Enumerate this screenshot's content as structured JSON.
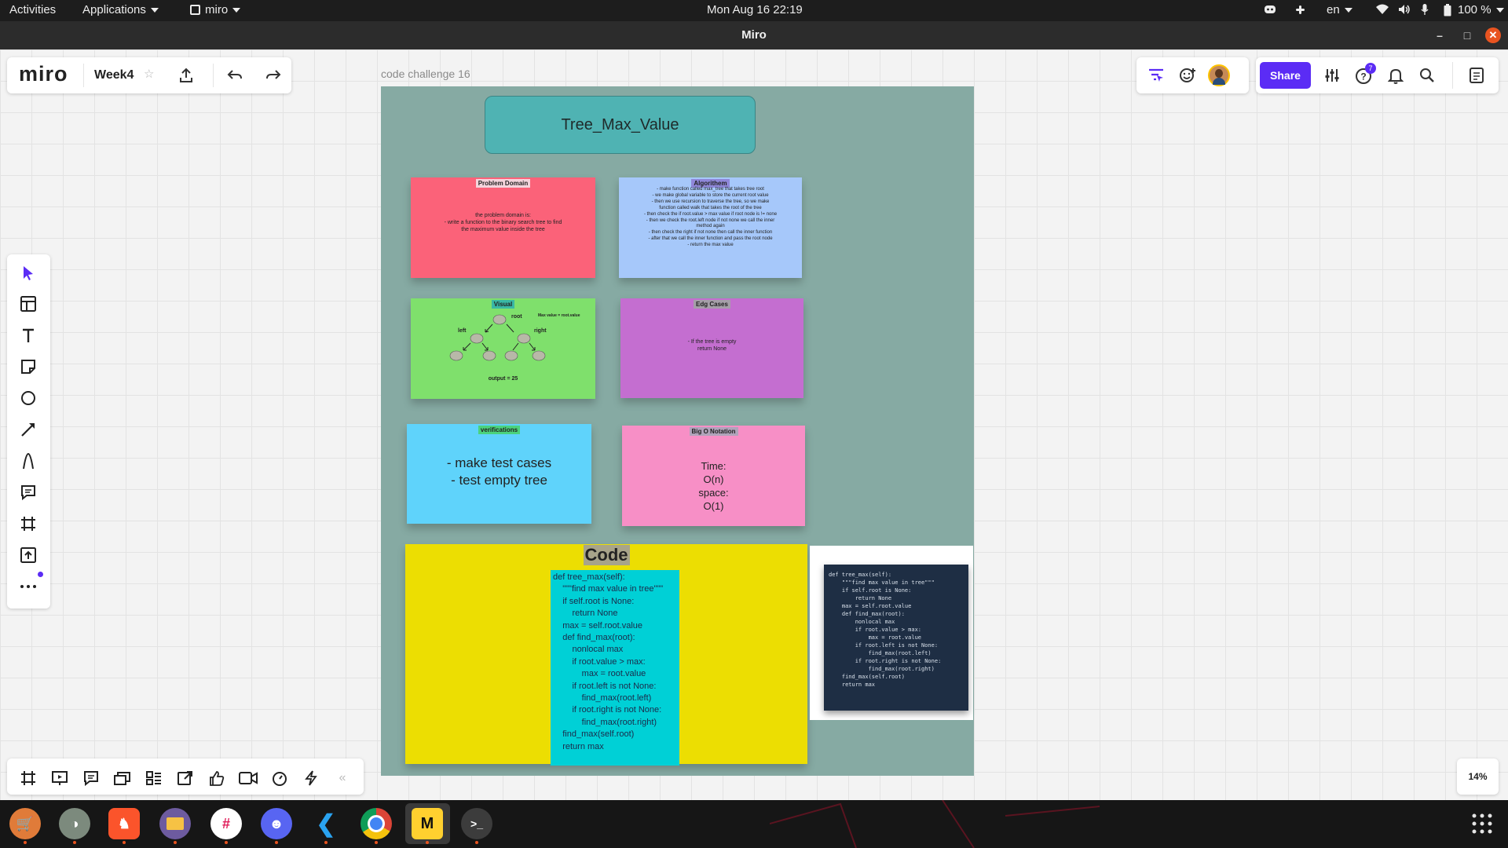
{
  "topbar": {
    "activities": "Activities",
    "applications": "Applications",
    "app": "miro",
    "clock": "Mon Aug 16  22:19",
    "language": "en",
    "battery": "100 %"
  },
  "window": {
    "title": "Miro"
  },
  "miro": {
    "logo": "miro",
    "board_name": "Week4",
    "share_label": "Share",
    "help_badge": "7",
    "zoom": "14%",
    "accent_color": "#5b2cf5"
  },
  "board": {
    "frame_label": "code challenge 16",
    "title_card": "Tree_Max_Value",
    "problem_domain": {
      "header": "Problem Domain",
      "body": "the problem domain is:\n- write a function to the binary search tree to find\nthe maximum value inside the tree"
    },
    "algorithm": {
      "header": "Algorithem",
      "body": "- make function called max_tree that takes tree root\n- we make global variable to store the current root value\n- then we use recursion to traverse the tree, so we make\nfunction called walk that takes the root of the tree\n- then check the if root.value > max value if root node is != none\n- then we check the root.left node if not none we call the inner\nmethod again\n- then check the right if not none then call the inner function\n- after that we call the inner function and pass the root node\n- return the max value"
    },
    "visual": {
      "header": "Visual",
      "root_label": "root",
      "left_label": "left",
      "right_label": "right",
      "max_note": "Max value = root.value",
      "output": "output = 25"
    },
    "edge_cases": {
      "header": "Edg Cases",
      "body": "- If the tree is empty\nreturn None"
    },
    "verifications": {
      "header": "verifications",
      "body": "- make test cases\n- test empty tree"
    },
    "big_o": {
      "header": "Big O Notation",
      "line1": "Time:",
      "line2": "O(n)",
      "line3": "space:",
      "line4": "O(1)"
    },
    "code": {
      "header": "Code",
      "lines": [
        "def tree_max(self):",
        "    \"\"\"find max value in tree\"\"\"",
        "    if self.root is None:",
        "        return None",
        "    max = self.root.value",
        "    def find_max(root):",
        "        nonlocal max",
        "        if root.value > max:",
        "            max = root.value",
        "        if root.left is not None:",
        "            find_max(root.left)",
        "        if root.right is not None:",
        "            find_max(root.right)",
        "    find_max(self.root)",
        "    return max"
      ]
    },
    "code_image_lines": [
      "def tree_max(self):",
      "    \"\"\"find max value in tree\"\"\"",
      "    if self.root is None:",
      "        return None",
      "    max = self.root.value",
      "    def find_max(root):",
      "        nonlocal max",
      "        if root.value > max:",
      "            max = root.value",
      "        if root.left is not None:",
      "            find_max(root.left)",
      "        if root.right is not None:",
      "            find_max(root.right)",
      "    find_max(self.root)",
      "    return max"
    ]
  }
}
